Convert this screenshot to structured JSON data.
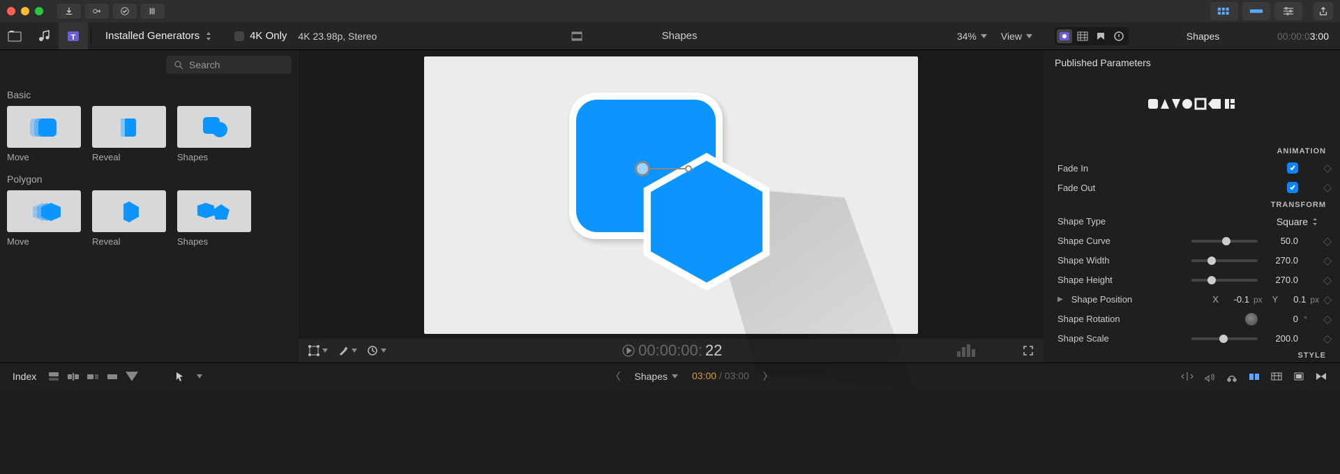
{
  "colors": {
    "accent": "#0a84ff",
    "shape": "#0d95ff"
  },
  "secondbar": {
    "dropdown": "Installed Generators",
    "fourk": "4K Only",
    "format": "4K 23.98p, Stereo",
    "title": "Shapes",
    "zoom": "34%",
    "view": "View"
  },
  "inspector_top": {
    "clip": "Shapes",
    "tc_gray": "00:00:0",
    "tc_white": "3:00"
  },
  "search_placeholder": "Search",
  "browser": {
    "categories": [
      {
        "name": "Basic",
        "items": [
          "Move",
          "Reveal",
          "Shapes"
        ]
      },
      {
        "name": "Polygon",
        "items": [
          "Move",
          "Reveal",
          "Shapes"
        ]
      }
    ]
  },
  "inspector": {
    "header": "Published Parameters",
    "logo": "SHAPES",
    "sections": {
      "animation": {
        "title": "ANIMATION",
        "rows": [
          {
            "label": "Fade In",
            "type": "check",
            "checked": true
          },
          {
            "label": "Fade Out",
            "type": "check",
            "checked": true
          }
        ]
      },
      "transform": {
        "title": "TRANSFORM",
        "shape_type": {
          "label": "Shape Type",
          "value": "Square"
        },
        "shape_curve": {
          "label": "Shape Curve",
          "value": "50.0",
          "pct": 50
        },
        "shape_width": {
          "label": "Shape Width",
          "value": "270.0",
          "pct": 27
        },
        "shape_height": {
          "label": "Shape Height",
          "value": "270.0",
          "pct": 27
        },
        "shape_position": {
          "label": "Shape Position",
          "x_label": "X",
          "x_value": "-0.1",
          "x_unit": "px",
          "y_label": "Y",
          "y_value": "0.1",
          "y_unit": "px"
        },
        "shape_rotation": {
          "label": "Shape Rotation",
          "value": "0",
          "unit": "°"
        },
        "shape_scale": {
          "label": "Shape Scale",
          "value": "200.0",
          "pct": 45
        }
      },
      "style": {
        "title": "STYLE"
      }
    }
  },
  "viewer_toolbar": {
    "tc_gray": "00:00:00:",
    "tc_frames": "22"
  },
  "timeline": {
    "index": "Index",
    "name": "Shapes",
    "elapsed": "03:00",
    "total": "03:00",
    "sep": " / "
  }
}
